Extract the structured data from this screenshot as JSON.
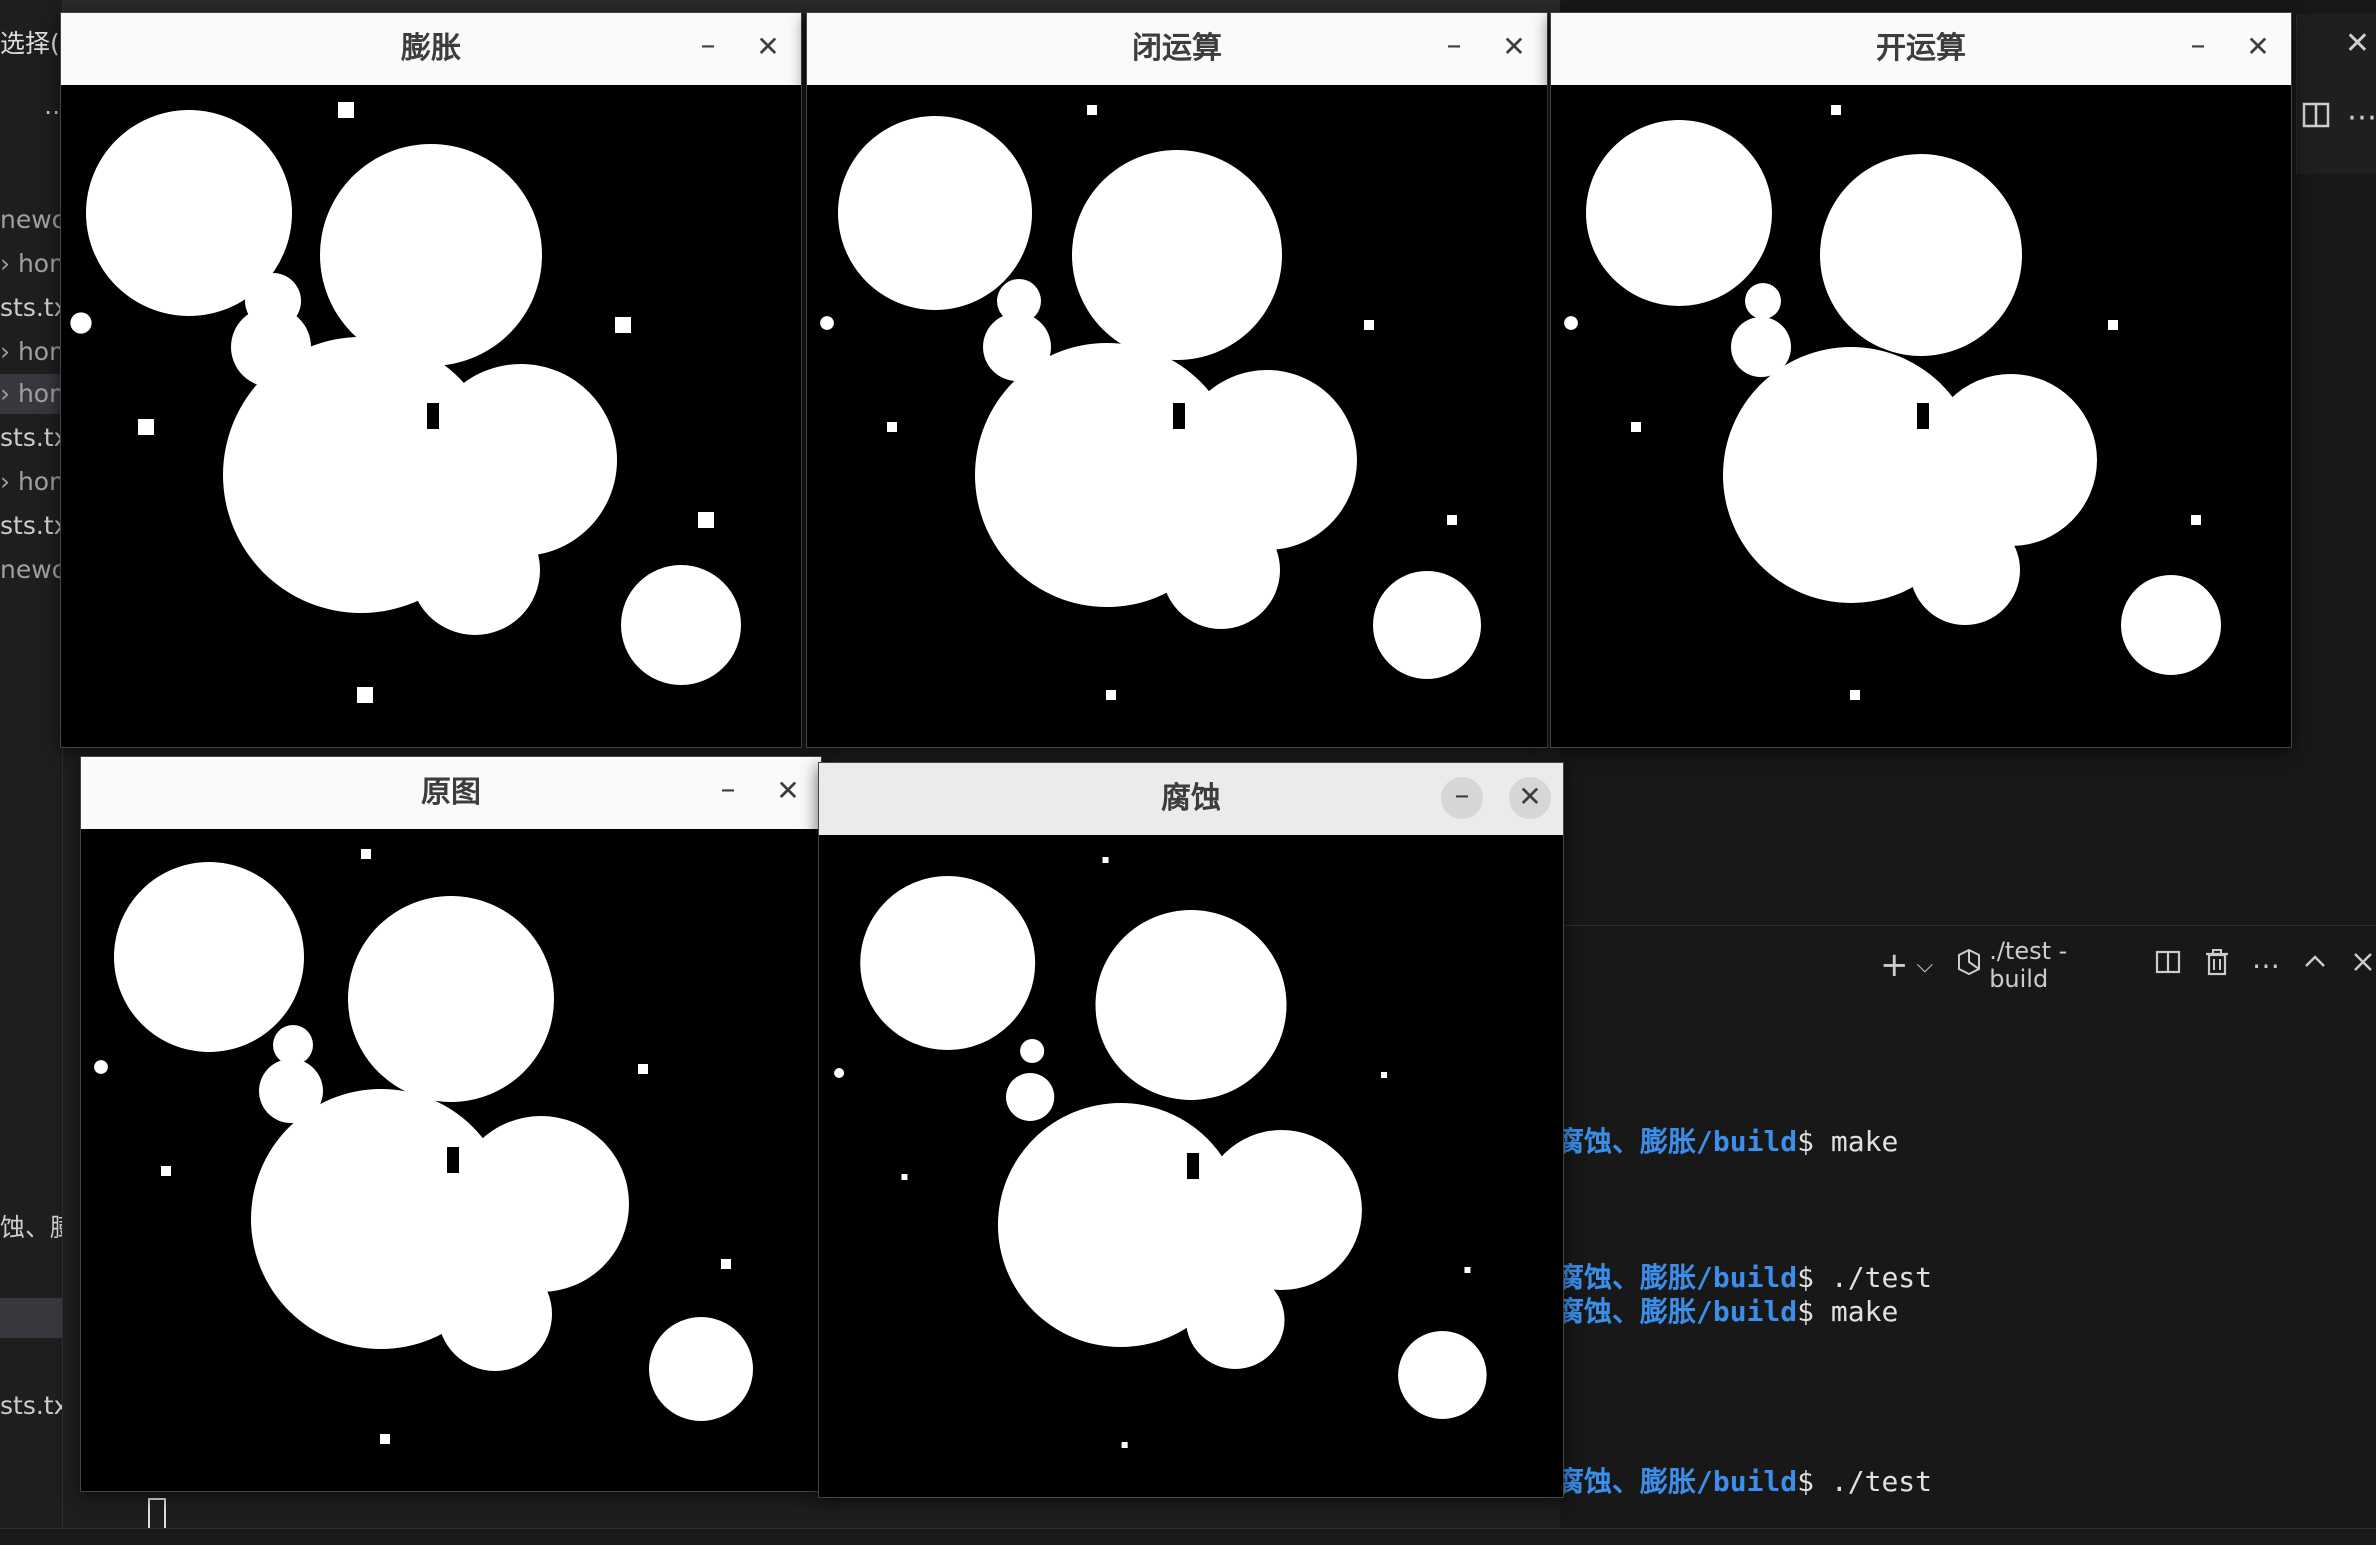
{
  "ide": {
    "sidebar_title": "选择(S",
    "sidebar_dots": "⋯",
    "sidebar_items": [
      {
        "label": "newor",
        "dim": true
      },
      {
        "label": "› hom",
        "dim": true
      },
      {
        "label": "sts.tx",
        "dim": false
      },
      {
        "label": "› hom",
        "dim": true
      },
      {
        "label": "› hom",
        "dim": true,
        "selected": true
      },
      {
        "label": "sts.tx",
        "dim": false
      },
      {
        "label": "› hom",
        "dim": true
      },
      {
        "label": "sts.tx",
        "dim": false
      },
      {
        "label": "newor",
        "dim": true
      }
    ],
    "sidebar_lower": [
      {
        "label": "蚀、膨胀"
      },
      {
        "label": "sts.txt"
      }
    ],
    "right_close": "✕",
    "right_split_icon": "split-editor-icon",
    "right_more_icon": "more-icon"
  },
  "terminal": {
    "toolbar": {
      "add_label": "+",
      "add_chevron": "⌵",
      "title": "./test - build",
      "split_icon": "split-terminal-icon",
      "trash_icon": "trash-icon",
      "more_icon": "more-icon",
      "maximize_icon": "chevron-up-icon",
      "close_icon": "close-icon"
    },
    "lines": [
      {
        "path": "腐蚀、膨胀/build",
        "cmd": "$ make"
      },
      {
        "path": "腐蚀、膨胀/build",
        "cmd": "$ ./test"
      },
      {
        "path": "腐蚀、膨胀/build",
        "cmd": "$ make"
      },
      {
        "path": "腐蚀、膨胀/build",
        "cmd": "$ ./test"
      }
    ]
  },
  "windows": [
    {
      "id": "dilate",
      "title": "膨胀",
      "min": "–",
      "close": "✕",
      "active": false,
      "mode": "dilate"
    },
    {
      "id": "close",
      "title": "闭运算",
      "min": "–",
      "close": "✕",
      "active": false,
      "mode": "close"
    },
    {
      "id": "open",
      "title": "开运算",
      "min": "–",
      "close": "✕",
      "active": false,
      "mode": "open"
    },
    {
      "id": "orig",
      "title": "原图",
      "min": "–",
      "close": "✕",
      "active": false,
      "mode": "orig"
    },
    {
      "id": "erode",
      "title": "腐蚀",
      "min": "–",
      "close": "✕",
      "active": true,
      "mode": "erode"
    }
  ]
}
